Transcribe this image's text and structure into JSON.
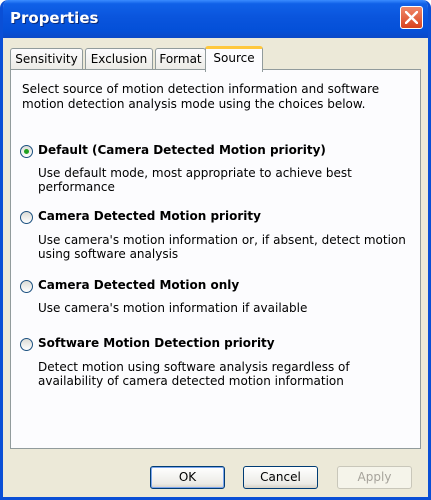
{
  "window": {
    "title": "Properties"
  },
  "tabs": [
    {
      "label": "Sensitivity",
      "active": false
    },
    {
      "label": "Exclusion",
      "active": false
    },
    {
      "label": "Format",
      "active": false
    },
    {
      "label": "Source",
      "active": true
    }
  ],
  "panel": {
    "intro": "Select source of motion detection information and software motion detection analysis mode using the choices below.",
    "options": [
      {
        "label": "Default (Camera Detected Motion priority)",
        "description": "Use default mode, most appropriate to achieve best performance",
        "selected": true
      },
      {
        "label": "Camera Detected Motion priority",
        "description": "Use camera's motion information or, if absent, detect motion using software analysis",
        "selected": false
      },
      {
        "label": "Camera Detected Motion only",
        "description": "Use camera's motion information if available",
        "selected": false
      },
      {
        "label": "Software Motion Detection priority",
        "description": "Detect motion using software analysis regardless of availability of camera detected motion information",
        "selected": false
      }
    ]
  },
  "buttons": {
    "ok": "OK",
    "cancel": "Cancel",
    "apply": "Apply",
    "apply_enabled": false
  },
  "colors": {
    "titlebar": "#0a55dd",
    "face": "#ece9d8",
    "active_tab_accent": "#ffc83c",
    "radio_dot": "#21a121",
    "close": "#d8431e"
  },
  "icons": {
    "close": "close-icon"
  }
}
